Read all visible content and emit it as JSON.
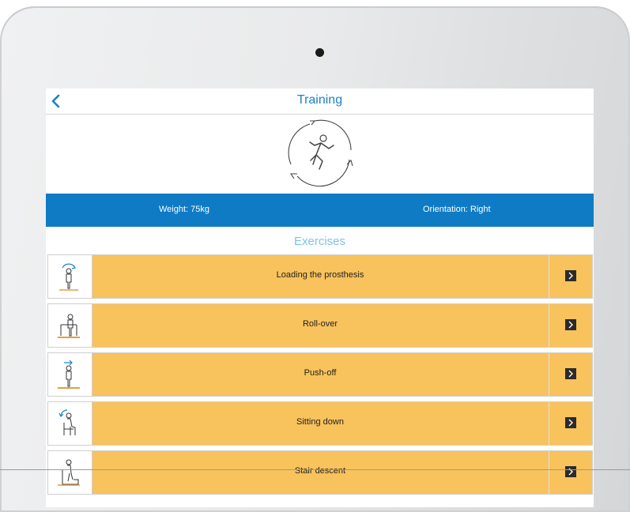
{
  "header": {
    "title": "Training"
  },
  "info_bar": {
    "weight": "Weight: 75kg",
    "orientation": "Orientation: Right"
  },
  "section_title": "Exercises",
  "exercises": [
    {
      "label": "Loading the prosthesis",
      "icon": "standing-person-icon"
    },
    {
      "label": "Roll-over",
      "icon": "person-at-rail-icon"
    },
    {
      "label": "Push-off",
      "icon": "person-push-off-icon"
    },
    {
      "label": "Sitting down",
      "icon": "person-sitting-icon"
    },
    {
      "label": "Stair descent",
      "icon": "person-stairs-icon"
    }
  ],
  "colors": {
    "primary_blue": "#0f7bc4",
    "title_blue": "#1c82c6",
    "section_blue": "#7cc3eb",
    "row_orange": "#f8c25c",
    "arrow_dark": "#2b2b2b"
  }
}
